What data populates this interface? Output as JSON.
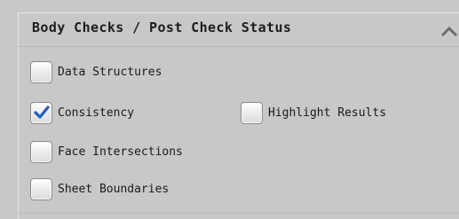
{
  "panel": {
    "title": "Body Checks / Post Check Status",
    "collapse_icon": "chevron-up-icon"
  },
  "checkboxes": [
    {
      "label": "Data Structures",
      "checked": false
    },
    {
      "label": "Consistency",
      "checked": true
    },
    {
      "label": "Highlight Results",
      "checked": false
    },
    {
      "label": "Face Intersections",
      "checked": false
    },
    {
      "label": "Sheet Boundaries",
      "checked": false
    }
  ],
  "colors": {
    "background": "#c8c8c8",
    "check_accent": "#1f5fbf"
  }
}
